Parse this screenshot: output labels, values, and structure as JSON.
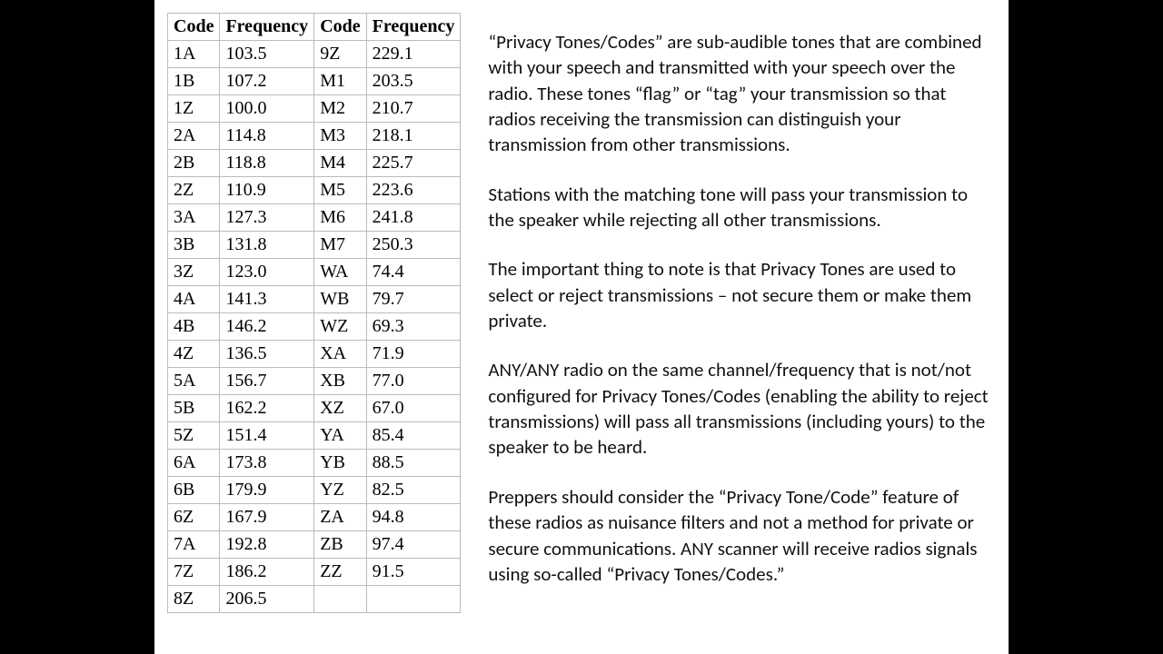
{
  "table": {
    "headers": [
      "Code",
      "Frequency",
      "Code",
      "Frequency"
    ],
    "rows": [
      [
        "1A",
        "103.5",
        "9Z",
        "229.1"
      ],
      [
        "1B",
        "107.2",
        "M1",
        "203.5"
      ],
      [
        "1Z",
        "100.0",
        "M2",
        "210.7"
      ],
      [
        "2A",
        "114.8",
        "M3",
        "218.1"
      ],
      [
        "2B",
        "118.8",
        "M4",
        "225.7"
      ],
      [
        "2Z",
        "110.9",
        "M5",
        "223.6"
      ],
      [
        "3A",
        "127.3",
        "M6",
        "241.8"
      ],
      [
        "3B",
        "131.8",
        "M7",
        "250.3"
      ],
      [
        "3Z",
        "123.0",
        "WA",
        "74.4"
      ],
      [
        "4A",
        "141.3",
        "WB",
        "79.7"
      ],
      [
        "4B",
        "146.2",
        "WZ",
        "69.3"
      ],
      [
        "4Z",
        "136.5",
        "XA",
        "71.9"
      ],
      [
        "5A",
        "156.7",
        "XB",
        "77.0"
      ],
      [
        "5B",
        "162.2",
        "XZ",
        "67.0"
      ],
      [
        "5Z",
        "151.4",
        "YA",
        "85.4"
      ],
      [
        "6A",
        "173.8",
        "YB",
        "88.5"
      ],
      [
        "6B",
        "179.9",
        "YZ",
        "82.5"
      ],
      [
        "6Z",
        "167.9",
        "ZA",
        "94.8"
      ],
      [
        "7A",
        "192.8",
        "ZB",
        "97.4"
      ],
      [
        "7Z",
        "186.2",
        "ZZ",
        "91.5"
      ],
      [
        "8Z",
        "206.5",
        "",
        ""
      ]
    ]
  },
  "paragraphs": [
    "“Privacy Tones/Codes” are sub-audible tones that are combined with your speech and transmitted with your speech over the radio.  These tones “flag” or “tag” your transmission so that radios receiving the transmission can distinguish your transmission from other transmissions.",
    "Stations with the matching tone will pass your transmission to the speaker while rejecting all other transmissions.",
    "The important thing to note is that Privacy Tones are used to select or reject transmissions – not secure them or make them private.",
    "ANY/ANY radio on the same channel/frequency that is not/not configured for Privacy Tones/Codes (enabling the ability to reject transmissions) will pass all transmissions (including yours) to the speaker to be heard.",
    "Preppers should consider the “Privacy Tone/Code” feature of these radios as nuisance filters and not a method for private or secure communications.  ANY scanner will receive radios signals using so-called “Privacy Tones/Codes.”"
  ]
}
